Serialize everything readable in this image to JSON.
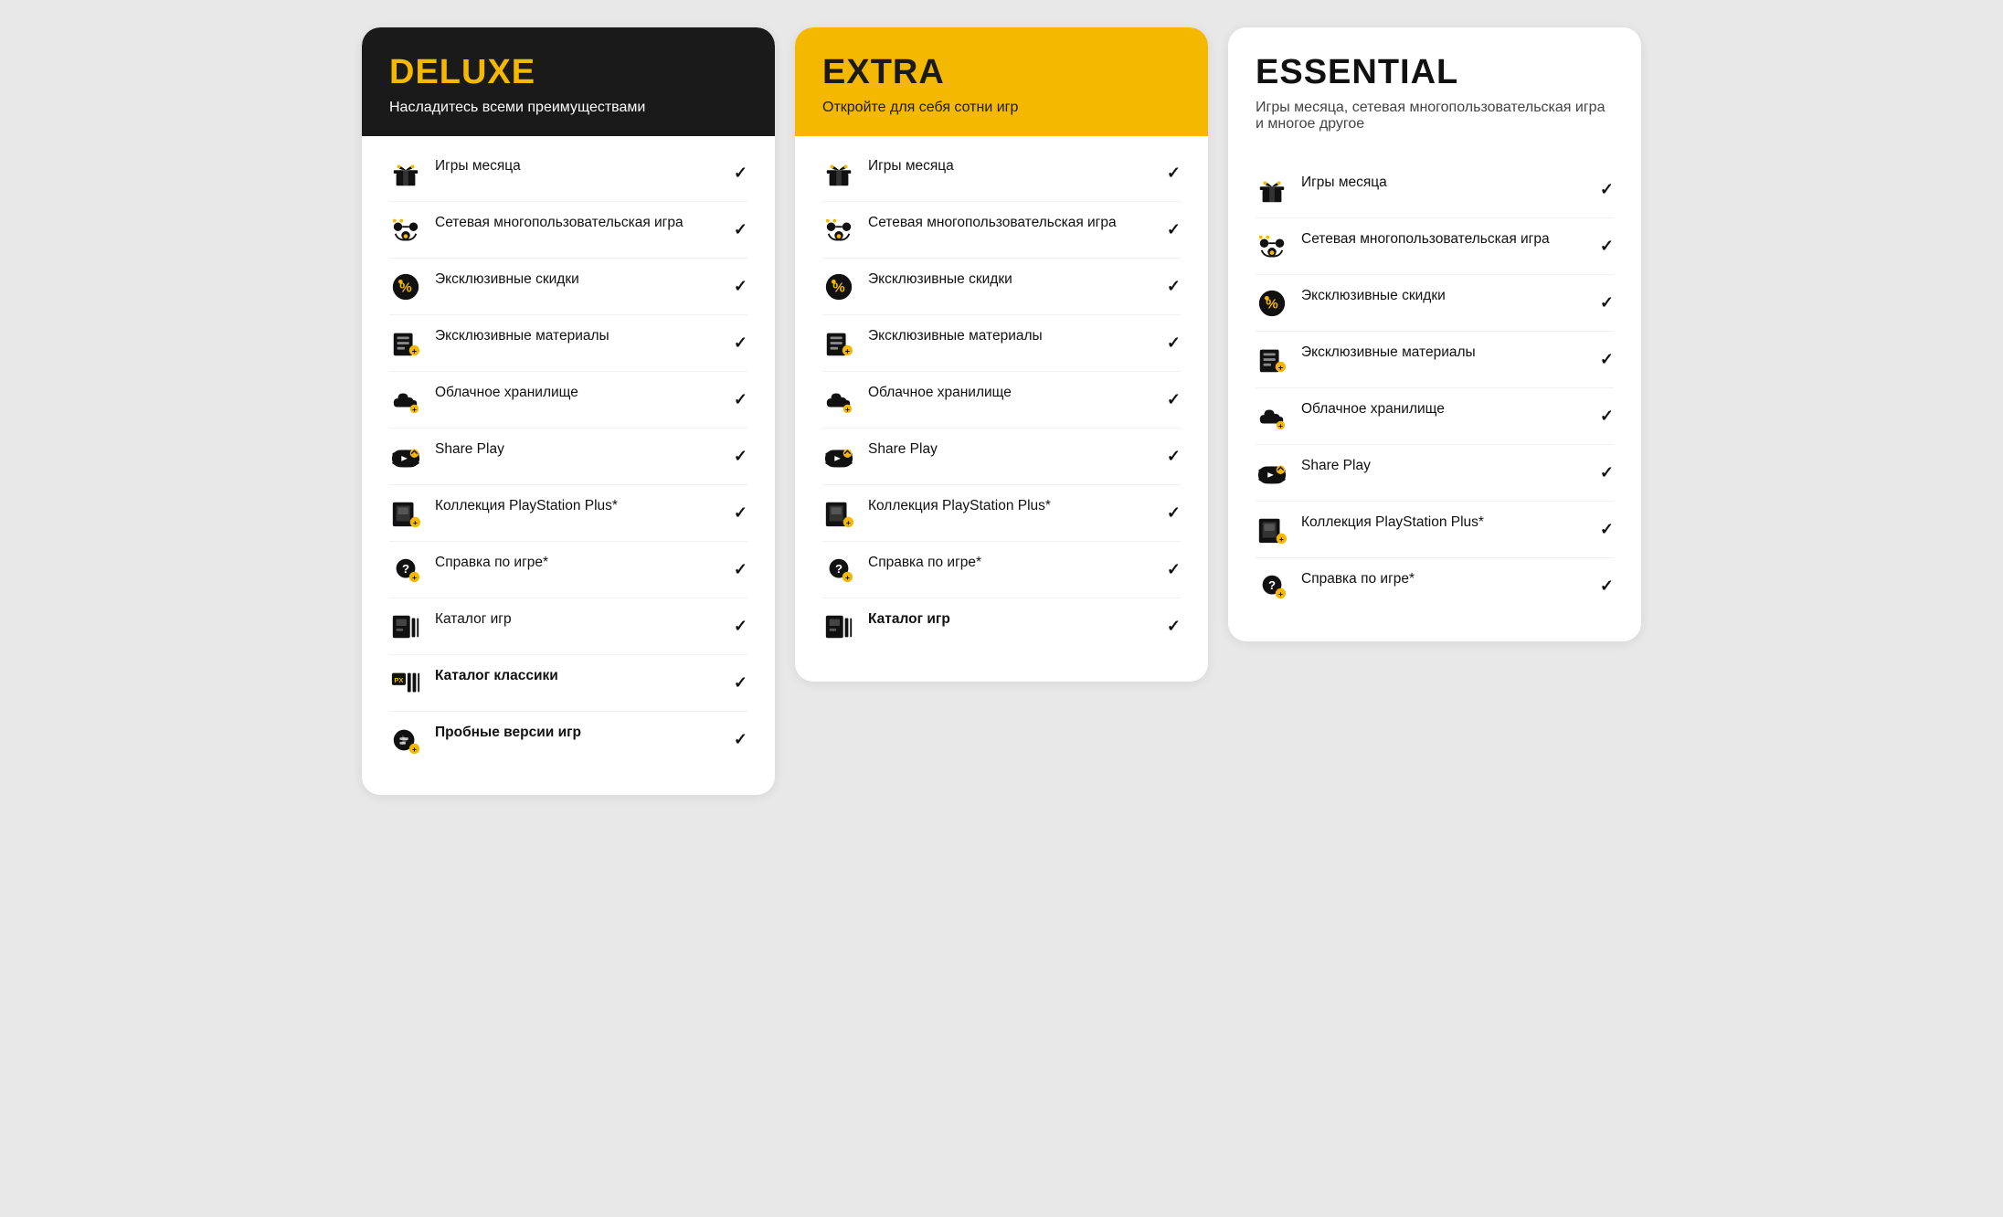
{
  "cards": [
    {
      "id": "deluxe",
      "header": {
        "style": "dark",
        "title": "DELUXE",
        "title_style": "yellow-text",
        "subtitle": "Насладитесь всеми преимуществами",
        "subtitle_style": "white-text"
      },
      "features": [
        {
          "icon": "gift",
          "text": "Игры месяца",
          "bold": false,
          "check": true
        },
        {
          "icon": "network-multiplayer",
          "text": "Сетевая многопользовательская игра",
          "bold": false,
          "check": true
        },
        {
          "icon": "discount",
          "text": "Эксклюзивные скидки",
          "bold": false,
          "check": true
        },
        {
          "icon": "exclusive-content",
          "text": "Эксклюзивные материалы",
          "bold": false,
          "check": true
        },
        {
          "icon": "cloud",
          "text": "Облачное хранилище",
          "bold": false,
          "check": true
        },
        {
          "icon": "share-play",
          "text": "Share Play",
          "bold": false,
          "check": true
        },
        {
          "icon": "ps-collection",
          "text": "Коллекция PlayStation Plus*",
          "bold": false,
          "check": true
        },
        {
          "icon": "game-help",
          "text": "Справка по игре*",
          "bold": false,
          "check": true
        },
        {
          "icon": "catalog",
          "text": "Каталог игр",
          "bold": false,
          "check": true
        },
        {
          "icon": "classics",
          "text": "Каталог классики",
          "bold": true,
          "check": true
        },
        {
          "icon": "trial",
          "text": "Пробные версии игр",
          "bold": true,
          "check": true
        }
      ]
    },
    {
      "id": "extra",
      "header": {
        "style": "yellow",
        "title": "EXTRA",
        "title_style": "dark-text",
        "subtitle": "Откройте для себя сотни игр",
        "subtitle_style": "dark-text"
      },
      "features": [
        {
          "icon": "gift",
          "text": "Игры месяца",
          "bold": false,
          "check": true
        },
        {
          "icon": "network-multiplayer",
          "text": "Сетевая многопользовательская игра",
          "bold": false,
          "check": true
        },
        {
          "icon": "discount",
          "text": "Эксклюзивные скидки",
          "bold": false,
          "check": true
        },
        {
          "icon": "exclusive-content",
          "text": "Эксклюзивные материалы",
          "bold": false,
          "check": true
        },
        {
          "icon": "cloud",
          "text": "Облачное хранилище",
          "bold": false,
          "check": true
        },
        {
          "icon": "share-play",
          "text": "Share Play",
          "bold": false,
          "check": true
        },
        {
          "icon": "ps-collection",
          "text": "Коллекция PlayStation Plus*",
          "bold": false,
          "check": true
        },
        {
          "icon": "game-help",
          "text": "Справка по игре*",
          "bold": false,
          "check": true
        },
        {
          "icon": "catalog",
          "text": "Каталог игр",
          "bold": true,
          "check": true
        }
      ]
    },
    {
      "id": "essential",
      "header": {
        "style": "white",
        "title": "ESSENTIAL",
        "title_style": "black-text",
        "subtitle": "Игры месяца, сетевая многопользовательская игра и многое другое",
        "subtitle_style": "gray-text"
      },
      "features": [
        {
          "icon": "gift",
          "text": "Игры месяца",
          "bold": false,
          "check": true
        },
        {
          "icon": "network-multiplayer",
          "text": "Сетевая многопользовательская игра",
          "bold": false,
          "check": true
        },
        {
          "icon": "discount",
          "text": "Эксклюзивные скидки",
          "bold": false,
          "check": true
        },
        {
          "icon": "exclusive-content",
          "text": "Эксклюзивные материалы",
          "bold": false,
          "check": true
        },
        {
          "icon": "cloud",
          "text": "Облачное хранилище",
          "bold": false,
          "check": true
        },
        {
          "icon": "share-play",
          "text": "Share Play",
          "bold": false,
          "check": true
        },
        {
          "icon": "ps-collection",
          "text": "Коллекция PlayStation Plus*",
          "bold": false,
          "check": true
        },
        {
          "icon": "game-help",
          "text": "Справка по игре*",
          "bold": false,
          "check": true
        }
      ]
    }
  ]
}
